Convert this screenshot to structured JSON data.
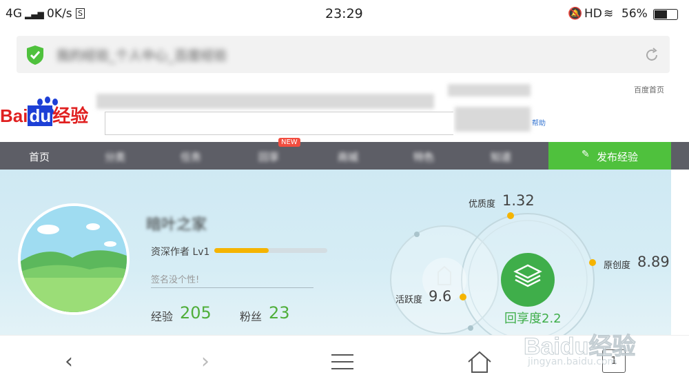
{
  "status_bar": {
    "network": "4G",
    "speed": "0K/s",
    "time": "23:29",
    "hd": "HD",
    "battery": "56%"
  },
  "address_bar": {
    "title": "我的经验_个人中心_百度经验"
  },
  "logo": {
    "text_bai": "Bai",
    "text_du": "du",
    "text_jingyan": "经验"
  },
  "header": {
    "right_link": "百度首页",
    "help": "帮助"
  },
  "nav": {
    "items": [
      "首页",
      "分类",
      "任务",
      "回享",
      "商城",
      "特色",
      "知道"
    ],
    "new_badge": "NEW",
    "publish": "发布经验"
  },
  "profile": {
    "username": "暗叶之家",
    "level_label": "资深作者 Lv1",
    "level_progress": 0.48,
    "signature_placeholder": "签名没个性!",
    "stats": [
      {
        "label": "经验",
        "value": "205"
      },
      {
        "label": "粉丝",
        "value": "23"
      }
    ]
  },
  "scores": {
    "quality_label": "优质度",
    "quality_value": "1.32",
    "original_label": "原创度",
    "original_value": "8.89",
    "activity_label": "活跃度",
    "activity_value": "9.6",
    "share_label": "回享度",
    "share_value": "2.2"
  },
  "colors": {
    "green": "#4fc13d",
    "nav_bg": "#5d5e66",
    "orange_dot": "#f5b400"
  },
  "watermark": {
    "brand": "Baidu经验",
    "url": "jingyan.baidu.com"
  },
  "bottom_bar": {
    "tab_count": "1"
  }
}
